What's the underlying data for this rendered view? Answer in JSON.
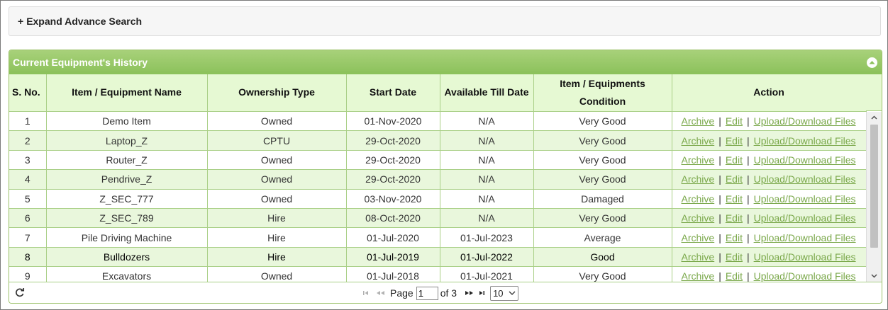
{
  "advance_search": {
    "plus": "+",
    "label": "Expand Advance Search"
  },
  "panel": {
    "title": "Current Equipment's History"
  },
  "columns": {
    "sno": "S. No.",
    "name": "Item / Equipment Name",
    "ownership": "Ownership Type",
    "start": "Start Date",
    "till": "Available Till Date",
    "condition_line1": "Item / Equipments",
    "condition_line2": "Condition",
    "action": "Action"
  },
  "actions": {
    "archive": "Archive",
    "edit": "Edit",
    "files": "Upload/Download Files",
    "sep": "|"
  },
  "rows": [
    {
      "sno": "1",
      "name": "Demo Item",
      "ownership": "Owned",
      "start": "01-Nov-2020",
      "till": "N/A",
      "condition": "Very Good"
    },
    {
      "sno": "2",
      "name": "Laptop_Z",
      "ownership": "CPTU",
      "start": "29-Oct-2020",
      "till": "N/A",
      "condition": "Very Good"
    },
    {
      "sno": "3",
      "name": "Router_Z",
      "ownership": "Owned",
      "start": "29-Oct-2020",
      "till": "N/A",
      "condition": "Very Good"
    },
    {
      "sno": "4",
      "name": "Pendrive_Z",
      "ownership": "Owned",
      "start": "29-Oct-2020",
      "till": "N/A",
      "condition": "Very Good"
    },
    {
      "sno": "5",
      "name": "Z_SEC_777",
      "ownership": "Owned",
      "start": "03-Nov-2020",
      "till": "N/A",
      "condition": "Damaged"
    },
    {
      "sno": "6",
      "name": "Z_SEC_789",
      "ownership": "Hire",
      "start": "08-Oct-2020",
      "till": "N/A",
      "condition": "Very Good"
    },
    {
      "sno": "7",
      "name": "Pile Driving Machine",
      "ownership": "Hire",
      "start": "01-Jul-2020",
      "till": "01-Jul-2023",
      "condition": "Average"
    },
    {
      "sno": "8",
      "name": "Bulldozers",
      "ownership": "Hire",
      "start": "01-Jul-2019",
      "till": "01-Jul-2022",
      "condition": "Good"
    },
    {
      "sno": "9",
      "name": "Excavators",
      "ownership": "Owned",
      "start": "01-Jul-2018",
      "till": "01-Jul-2021",
      "condition": "Very Good"
    }
  ],
  "pager": {
    "page_label": "Page",
    "page_value": "1",
    "of_label": "of 3",
    "rows_per_page": "10"
  },
  "colors": {
    "header_green": "#8bc15a",
    "row_alt": "#e9f7dc",
    "link": "#7aa84a",
    "column_header": "#e6f9d3"
  },
  "icons": {
    "collapse": "circle-chevron-up-icon",
    "refresh": "refresh-icon",
    "first": "first-page-icon",
    "prev": "prev-page-icon",
    "next": "next-page-icon",
    "last": "last-page-icon"
  }
}
